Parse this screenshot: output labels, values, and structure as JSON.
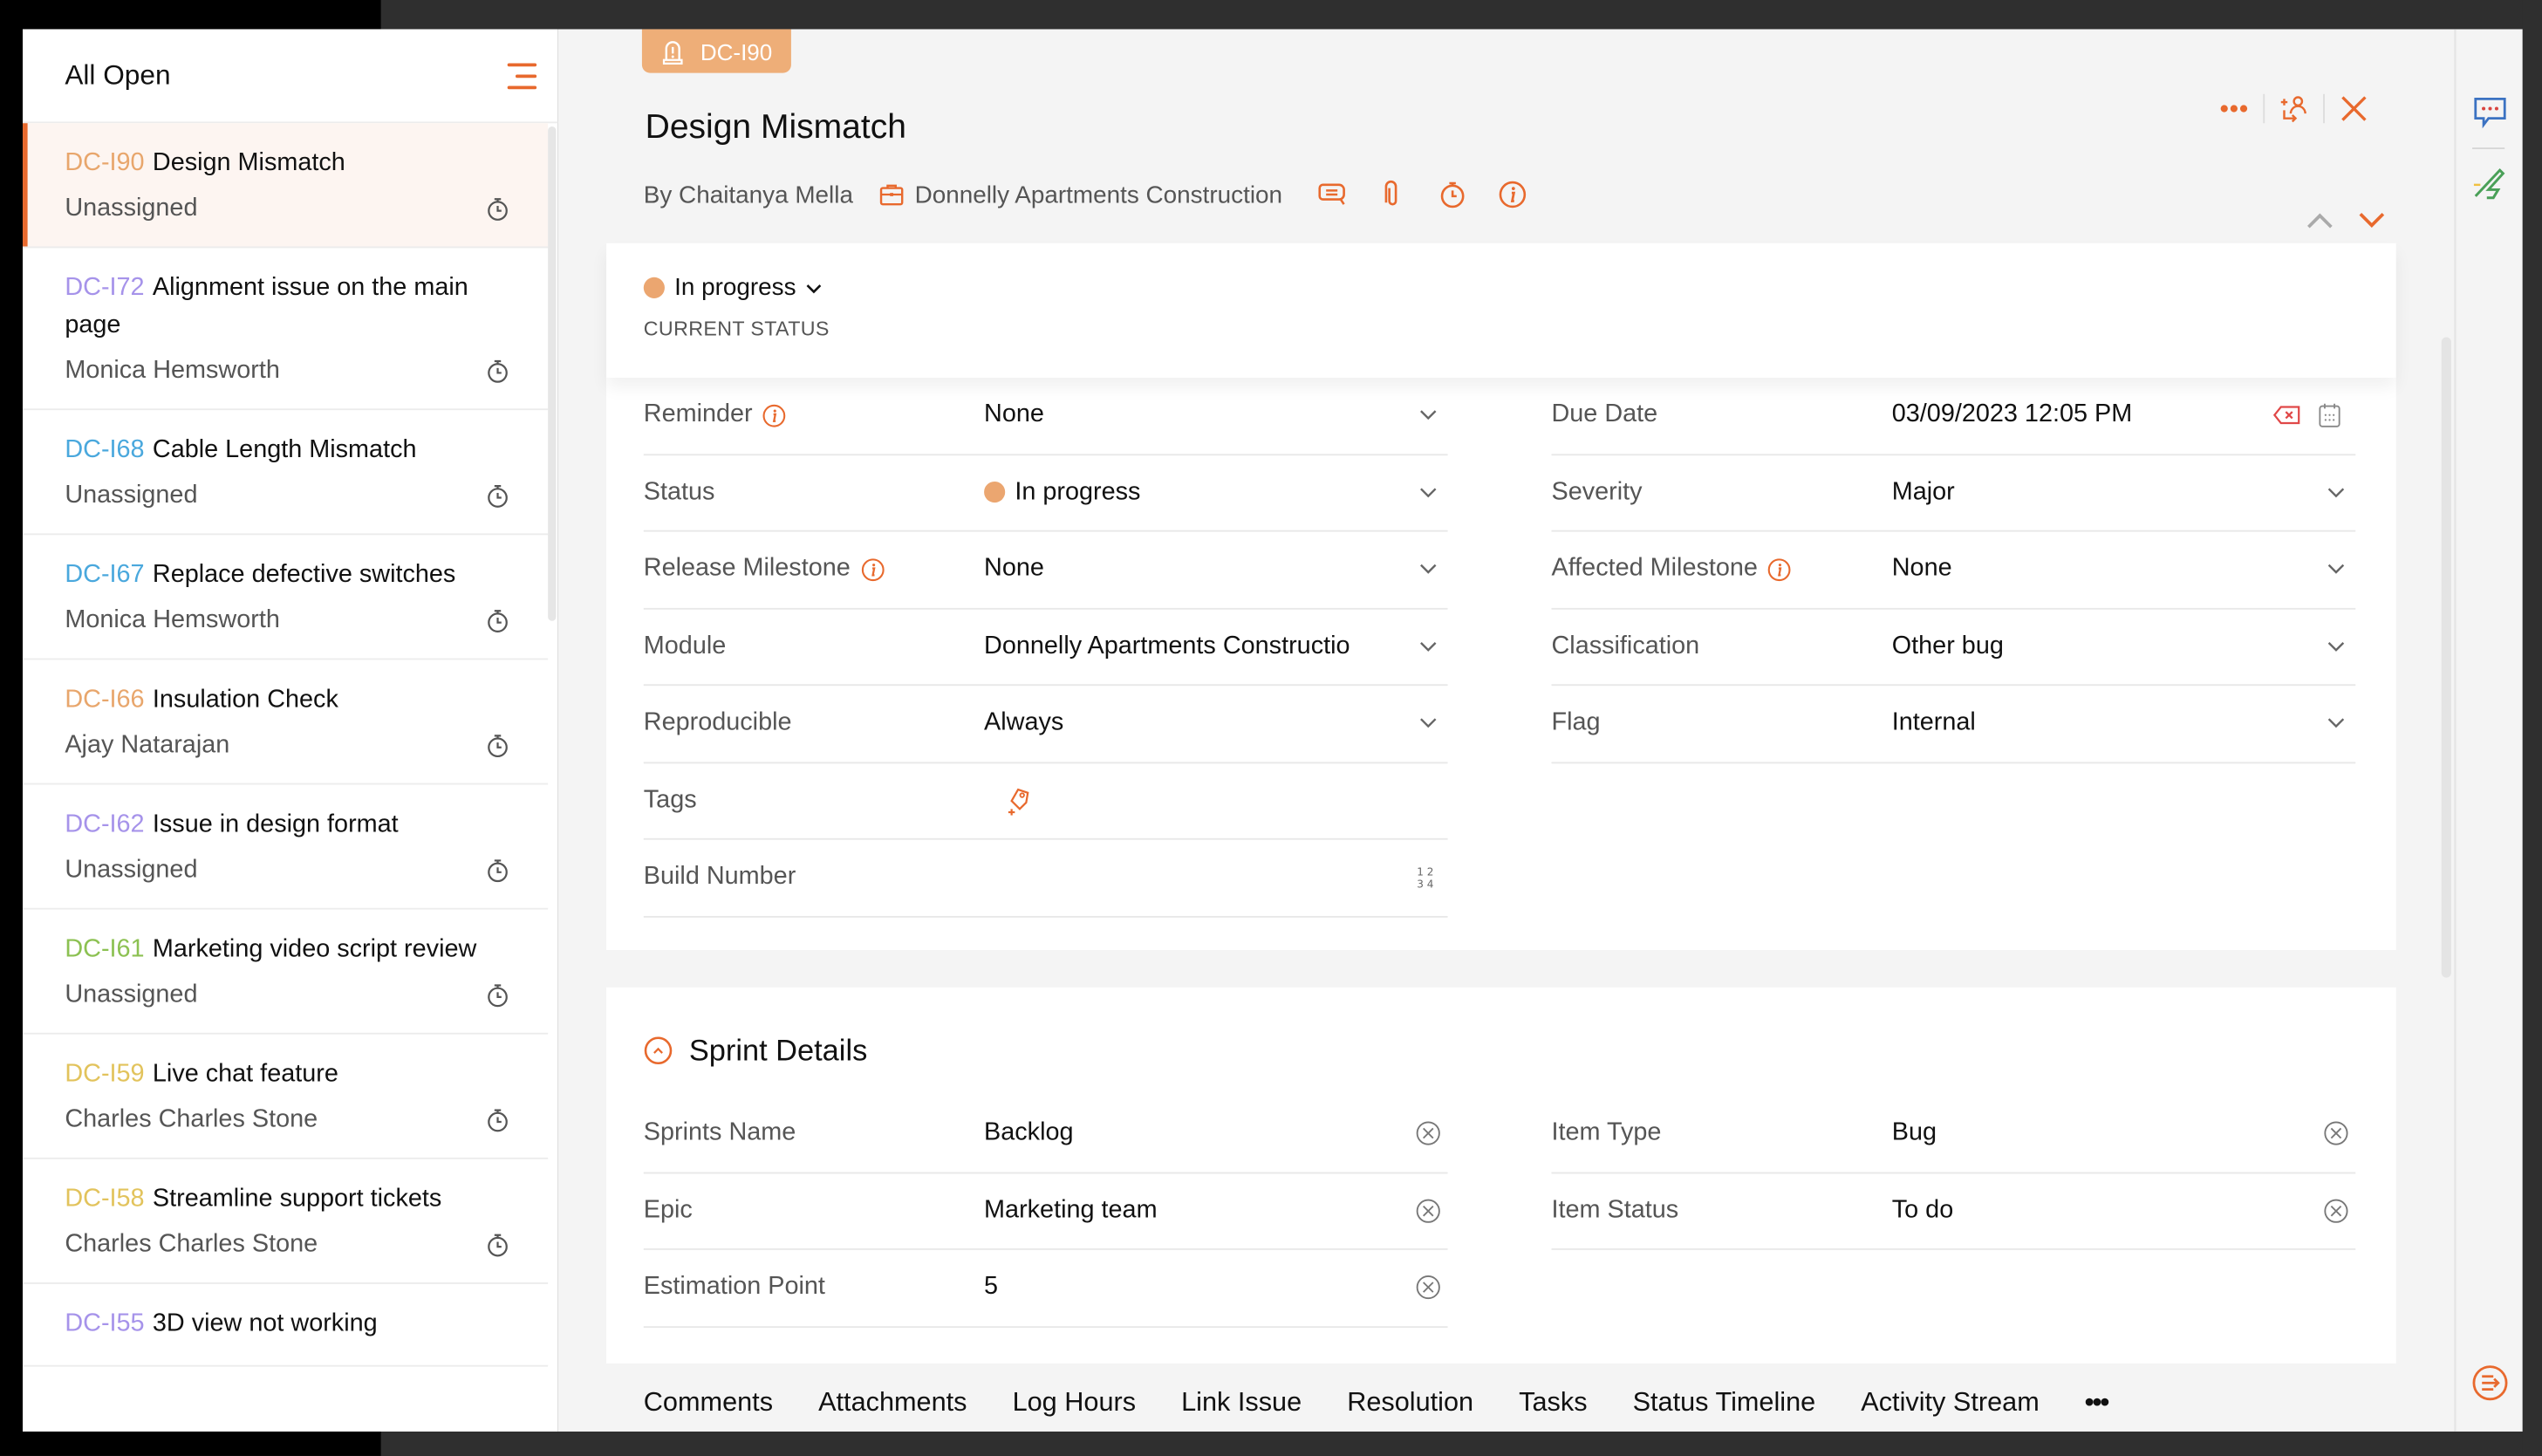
{
  "list": {
    "title": "All Open",
    "items": [
      {
        "id": "DC-I90",
        "id_color": "#e8a66c",
        "title": "Design Mismatch",
        "assignee": "Unassigned",
        "active": true
      },
      {
        "id": "DC-I72",
        "id_color": "#a693ea",
        "title": "Alignment issue on the main page",
        "assignee": "Monica Hemsworth"
      },
      {
        "id": "DC-I68",
        "id_color": "#4aa8dd",
        "title": "Cable Length Mismatch",
        "assignee": "Unassigned"
      },
      {
        "id": "DC-I67",
        "id_color": "#4aa8dd",
        "title": "Replace defective switches",
        "assignee": "Monica Hemsworth"
      },
      {
        "id": "DC-I66",
        "id_color": "#e8a66c",
        "title": "Insulation Check",
        "assignee": "Ajay Natarajan"
      },
      {
        "id": "DC-I62",
        "id_color": "#a693ea",
        "title": "Issue in design format",
        "assignee": "Unassigned"
      },
      {
        "id": "DC-I61",
        "id_color": "#8cc152",
        "title": "Marketing video script review",
        "assignee": "Unassigned"
      },
      {
        "id": "DC-I59",
        "id_color": "#e2c35c",
        "title": "Live chat feature",
        "assignee": "Charles Charles Stone"
      },
      {
        "id": "DC-I58",
        "id_color": "#e2c35c",
        "title": "Streamline support tickets",
        "assignee": "Charles Charles Stone"
      },
      {
        "id": "DC-I55",
        "id_color": "#a693ea",
        "title": "3D view not working",
        "assignee": ""
      }
    ]
  },
  "issue": {
    "badge_id": "DC-I90",
    "title": "Design Mismatch",
    "author": "By Chaitanya Mella",
    "project": "Donnelly Apartments Construction",
    "current_status": "In progress",
    "current_status_caption": "CURRENT STATUS"
  },
  "fields_left": [
    {
      "label": "Reminder",
      "info": true,
      "value": "None",
      "control": "dropdown"
    },
    {
      "label": "Status",
      "value": "In progress",
      "dot": true,
      "control": "dropdown"
    },
    {
      "label": "Release Milestone",
      "info": true,
      "value": "None",
      "control": "dropdown"
    },
    {
      "label": "Module",
      "value": "Donnelly Apartments Constructio",
      "control": "dropdown"
    },
    {
      "label": "Reproducible",
      "value": "Always",
      "control": "dropdown"
    },
    {
      "label": "Tags",
      "value": "",
      "control": "tag-add"
    },
    {
      "label": "Build Number",
      "value": "",
      "control": "number"
    }
  ],
  "fields_right": [
    {
      "label": "Due Date",
      "value": "03/09/2023 12:05 PM",
      "control": "date"
    },
    {
      "label": "Severity",
      "value": "Major",
      "control": "dropdown"
    },
    {
      "label": "Affected Milestone",
      "info": true,
      "value": "None",
      "control": "dropdown"
    },
    {
      "label": "Classification",
      "value": "Other bug",
      "control": "dropdown"
    },
    {
      "label": "Flag",
      "value": "Internal",
      "control": "dropdown"
    }
  ],
  "sprint": {
    "title": "Sprint Details",
    "left": [
      {
        "label": "Sprints Name",
        "value": "Backlog"
      },
      {
        "label": "Epic",
        "value": "Marketing team"
      },
      {
        "label": "Estimation Point",
        "value": "5"
      }
    ],
    "right": [
      {
        "label": "Item Type",
        "value": "Bug"
      },
      {
        "label": "Item Status",
        "value": "To do"
      }
    ]
  },
  "tabs": [
    "Comments",
    "Attachments",
    "Log Hours",
    "Link Issue",
    "Resolution",
    "Tasks",
    "Status Timeline",
    "Activity Stream",
    "•••"
  ],
  "icons": {
    "menu": "menu-icon",
    "more": "more-horizontal-icon",
    "assign": "assign-user-icon",
    "close": "close-icon",
    "prev": "chevron-up-icon",
    "next": "chevron-down-icon",
    "comment": "comment-icon",
    "attachment": "paperclip-icon",
    "timer": "timer-icon",
    "info": "info-icon",
    "chat": "chat-icon",
    "sign": "signature-icon",
    "collapse_right": "expand-panel-icon"
  },
  "colors": {
    "accent": "#e8692d",
    "badge": "#eeae78",
    "status_dot": "#eba670"
  }
}
